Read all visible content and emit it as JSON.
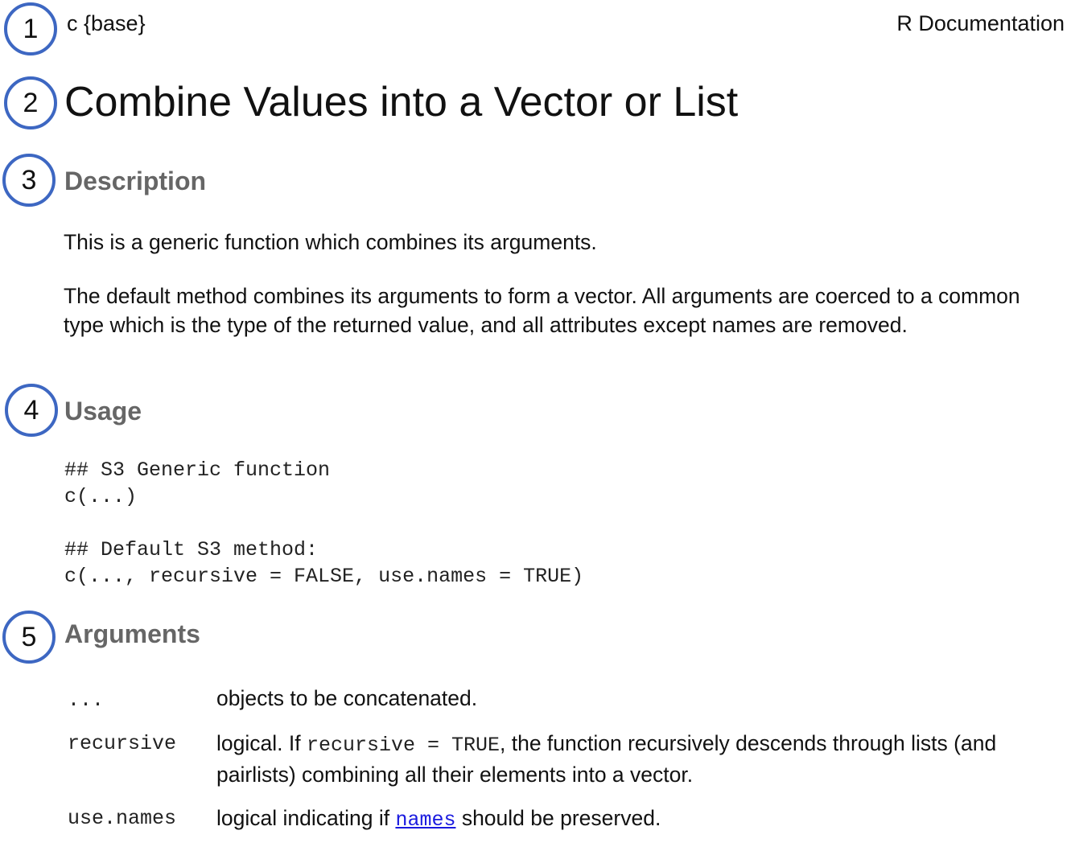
{
  "header": {
    "package": "c {base}",
    "doc_label": "R Documentation"
  },
  "title": "Combine Values into a Vector or List",
  "markers": [
    "1",
    "2",
    "3",
    "4",
    "5"
  ],
  "description": {
    "heading": "Description",
    "para1": "This is a generic function which combines its arguments.",
    "para2": "The default method combines its arguments to form a vector. All arguments are coerced to a common type which is the type of the returned value, and all attributes except names are removed."
  },
  "usage": {
    "heading": "Usage",
    "line1": "## S3 Generic function",
    "line2": "c(...)",
    "line3": "## Default S3 method:",
    "line4": "c(..., recursive = FALSE, use.names = TRUE)"
  },
  "arguments": {
    "heading": "Arguments",
    "items": [
      {
        "name": "...",
        "desc": "objects to be concatenated."
      },
      {
        "name": "recursive",
        "desc_a": "logical. If ",
        "desc_code": "recursive = TRUE",
        "desc_b": ", the function recursively descends through lists (and pairlists) combining all their elements into a vector."
      },
      {
        "name": "use.names",
        "desc_a": "logical indicating if ",
        "desc_link": "names",
        "desc_b": " should be preserved."
      }
    ]
  }
}
